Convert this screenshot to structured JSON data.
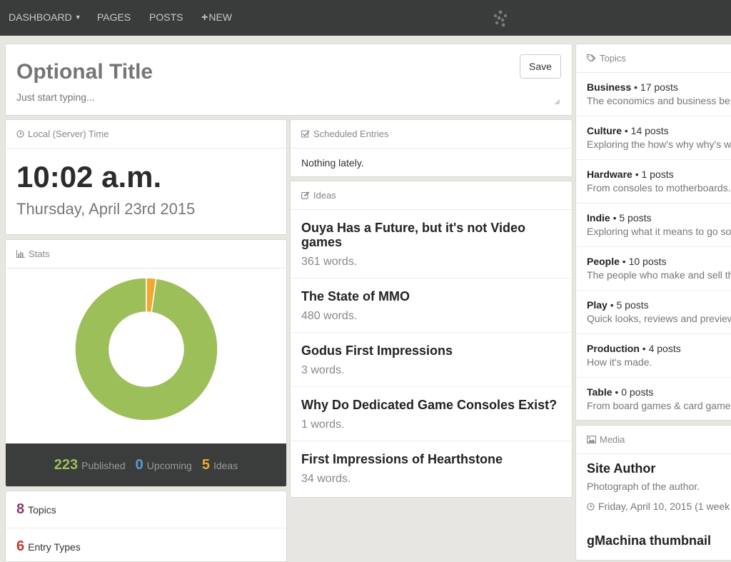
{
  "nav": {
    "dashboard": "DASHBOARD",
    "pages": "PAGES",
    "posts": "POSTS",
    "new": "NEW"
  },
  "compose": {
    "title_placeholder": "Optional Title",
    "body_placeholder": "Just start typing...",
    "save_label": "Save"
  },
  "time_panel": {
    "heading": "Local (Server) Time",
    "time": "10:02 a.m.",
    "date": "Thursday, April 23rd 2015"
  },
  "stats": {
    "heading": "Stats",
    "published": 223,
    "published_label": "Published",
    "upcoming": 0,
    "upcoming_label": "Upcoming",
    "ideas": 5,
    "ideas_label": "Ideas",
    "colors": {
      "published": "#9cbf5a",
      "upcoming": "#5b9bd5",
      "ideas": "#f0a830"
    }
  },
  "counts": {
    "topics_num": "8",
    "topics_label": "Topics",
    "entry_types_num": "6",
    "entry_types_label": "Entry Types",
    "topics_color": "#8e3b6d",
    "entry_types_color": "#c0392b"
  },
  "scheduled": {
    "heading": "Scheduled Entries",
    "empty_text": "Nothing lately."
  },
  "ideas": {
    "heading": "Ideas",
    "items": [
      {
        "title": "Ouya Has a Future, but it's not Video games",
        "words": "361 words."
      },
      {
        "title": "The State of MMO",
        "words": "480 words."
      },
      {
        "title": "Godus First Impressions",
        "words": "3 words."
      },
      {
        "title": "Why Do Dedicated Game Consoles Exist?",
        "words": "1 words."
      },
      {
        "title": "First Impressions of Hearthstone",
        "words": "34 words."
      }
    ]
  },
  "topics": {
    "heading": "Topics",
    "items": [
      {
        "name": "Business",
        "count": "• 17 posts",
        "desc": "The economics and business be"
      },
      {
        "name": "Culture",
        "count": "• 14 posts",
        "desc": "Exploring the how's why why's w"
      },
      {
        "name": "Hardware",
        "count": "• 1 posts",
        "desc": "From consoles to motherboards."
      },
      {
        "name": "Indie",
        "count": "• 5 posts",
        "desc": "Exploring what it means to go so"
      },
      {
        "name": "People",
        "count": "• 10 posts",
        "desc": "The people who make and sell th"
      },
      {
        "name": "Play",
        "count": "• 5 posts",
        "desc": "Quick looks, reviews and preview"
      },
      {
        "name": "Production",
        "count": "• 4 posts",
        "desc": "How it's made."
      },
      {
        "name": "Table",
        "count": "• 0 posts",
        "desc": "From board games & card game"
      }
    ]
  },
  "media": {
    "heading": "Media",
    "items": [
      {
        "title": "Site Author",
        "caption": "Photograph of the author.",
        "date": "Friday, April 10, 2015 (1 week"
      },
      {
        "title": "gMachina thumbnail"
      }
    ]
  }
}
